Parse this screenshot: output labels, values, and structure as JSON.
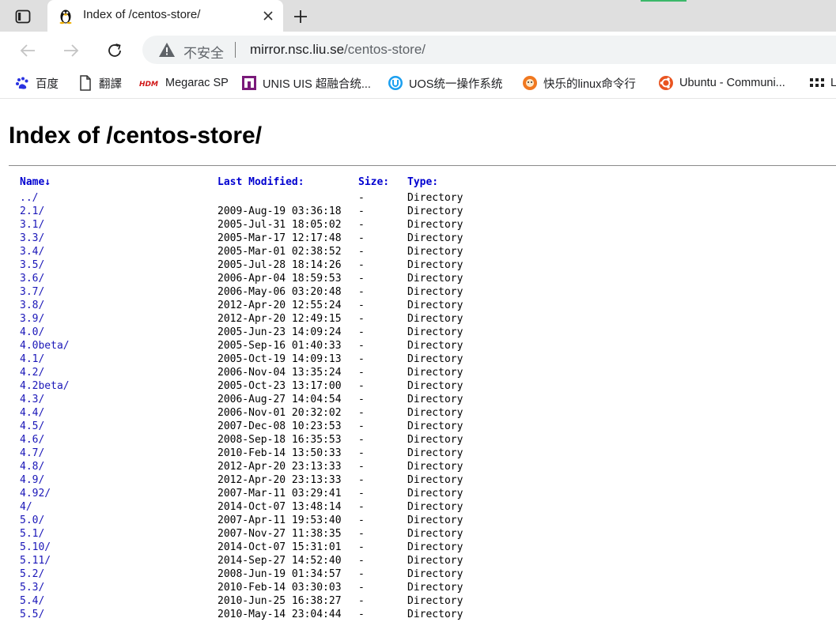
{
  "tab": {
    "title": "Index of /centos-store/"
  },
  "toolbar": {
    "security_label": "不安全",
    "url_host": "mirror.nsc.liu.se",
    "url_path": "/centos-store/"
  },
  "bookmarks": [
    {
      "label": "百度",
      "icon": "baidu-paw-icon"
    },
    {
      "label": "翻譯",
      "icon": "page-icon"
    },
    {
      "label": "Megarac SP",
      "icon": "hdm-logo-icon"
    },
    {
      "label": "UNIS UIS 超融合统...",
      "icon": "unis-logo-icon"
    },
    {
      "label": "UOS统一操作系统",
      "icon": "uos-logo-icon"
    },
    {
      "label": "快乐的linux命令行",
      "icon": "linux-site-icon"
    },
    {
      "label": "Ubuntu - Communi...",
      "icon": "ubuntu-logo-icon"
    },
    {
      "label": "L",
      "icon": "apps-grid-icon"
    }
  ],
  "page": {
    "title": "Index of /centos-store/",
    "columns": {
      "name": "Name",
      "sort_indicator": "↓",
      "modified": "Last Modified:",
      "size": "Size:",
      "type": "Type:"
    },
    "rows": [
      {
        "name": "../",
        "date": "",
        "size": "-",
        "type": "Directory"
      },
      {
        "name": "2.1/",
        "date": "2009-Aug-19 03:36:18",
        "size": "-",
        "type": "Directory"
      },
      {
        "name": "3.1/",
        "date": "2005-Jul-31 18:05:02",
        "size": "-",
        "type": "Directory"
      },
      {
        "name": "3.3/",
        "date": "2005-Mar-17 12:17:48",
        "size": "-",
        "type": "Directory"
      },
      {
        "name": "3.4/",
        "date": "2005-Mar-01 02:38:52",
        "size": "-",
        "type": "Directory"
      },
      {
        "name": "3.5/",
        "date": "2005-Jul-28 18:14:26",
        "size": "-",
        "type": "Directory"
      },
      {
        "name": "3.6/",
        "date": "2006-Apr-04 18:59:53",
        "size": "-",
        "type": "Directory"
      },
      {
        "name": "3.7/",
        "date": "2006-May-06 03:20:48",
        "size": "-",
        "type": "Directory"
      },
      {
        "name": "3.8/",
        "date": "2012-Apr-20 12:55:24",
        "size": "-",
        "type": "Directory"
      },
      {
        "name": "3.9/",
        "date": "2012-Apr-20 12:49:15",
        "size": "-",
        "type": "Directory"
      },
      {
        "name": "4.0/",
        "date": "2005-Jun-23 14:09:24",
        "size": "-",
        "type": "Directory"
      },
      {
        "name": "4.0beta/",
        "date": "2005-Sep-16 01:40:33",
        "size": "-",
        "type": "Directory"
      },
      {
        "name": "4.1/",
        "date": "2005-Oct-19 14:09:13",
        "size": "-",
        "type": "Directory"
      },
      {
        "name": "4.2/",
        "date": "2006-Nov-04 13:35:24",
        "size": "-",
        "type": "Directory"
      },
      {
        "name": "4.2beta/",
        "date": "2005-Oct-23 13:17:00",
        "size": "-",
        "type": "Directory"
      },
      {
        "name": "4.3/",
        "date": "2006-Aug-27 14:04:54",
        "size": "-",
        "type": "Directory"
      },
      {
        "name": "4.4/",
        "date": "2006-Nov-01 20:32:02",
        "size": "-",
        "type": "Directory"
      },
      {
        "name": "4.5/",
        "date": "2007-Dec-08 10:23:53",
        "size": "-",
        "type": "Directory"
      },
      {
        "name": "4.6/",
        "date": "2008-Sep-18 16:35:53",
        "size": "-",
        "type": "Directory"
      },
      {
        "name": "4.7/",
        "date": "2010-Feb-14 13:50:33",
        "size": "-",
        "type": "Directory"
      },
      {
        "name": "4.8/",
        "date": "2012-Apr-20 23:13:33",
        "size": "-",
        "type": "Directory"
      },
      {
        "name": "4.9/",
        "date": "2012-Apr-20 23:13:33",
        "size": "-",
        "type": "Directory"
      },
      {
        "name": "4.92/",
        "date": "2007-Mar-11 03:29:41",
        "size": "-",
        "type": "Directory"
      },
      {
        "name": "4/",
        "date": "2014-Oct-07 13:48:14",
        "size": "-",
        "type": "Directory"
      },
      {
        "name": "5.0/",
        "date": "2007-Apr-11 19:53:40",
        "size": "-",
        "type": "Directory"
      },
      {
        "name": "5.1/",
        "date": "2007-Nov-27 11:38:35",
        "size": "-",
        "type": "Directory"
      },
      {
        "name": "5.10/",
        "date": "2014-Oct-07 15:31:01",
        "size": "-",
        "type": "Directory"
      },
      {
        "name": "5.11/",
        "date": "2014-Sep-27 14:52:40",
        "size": "-",
        "type": "Directory"
      },
      {
        "name": "5.2/",
        "date": "2008-Jun-19 01:34:57",
        "size": "-",
        "type": "Directory"
      },
      {
        "name": "5.3/",
        "date": "2010-Feb-14 03:30:03",
        "size": "-",
        "type": "Directory"
      },
      {
        "name": "5.4/",
        "date": "2010-Jun-25 16:38:27",
        "size": "-",
        "type": "Directory"
      },
      {
        "name": "5.5/",
        "date": "2010-May-14 23:04:44",
        "size": "-",
        "type": "Directory"
      }
    ]
  }
}
